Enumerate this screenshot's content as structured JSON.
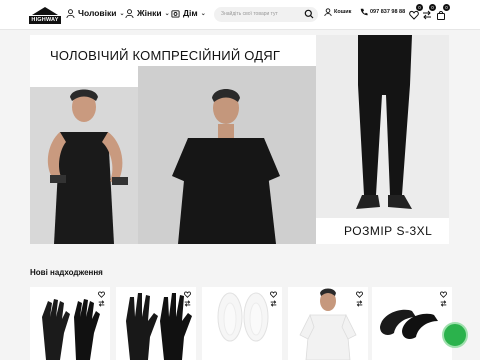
{
  "header": {
    "logo_text": "HIGHWAY",
    "nav": [
      {
        "label": "Чоловіки"
      },
      {
        "label": "Жінки"
      },
      {
        "label": "Дім"
      }
    ],
    "search_placeholder": "Знайдіть свої товари тут",
    "account_label": "Кошик",
    "phone": "097 837 98 88",
    "badges": {
      "wishlist": "0",
      "compare": "0",
      "cart": "0"
    }
  },
  "hero": {
    "title": "ЧОЛОВІЧИЙ КОМПРЕСІЙНИЙ ОДЯГ",
    "size_label": "РОЗМІР S-3XL"
  },
  "new_arrivals": {
    "title": "Нові надходження",
    "products": [
      {
        "name": "gloves-touch"
      },
      {
        "name": "gloves-sport"
      },
      {
        "name": "socks-white"
      },
      {
        "name": "tshirt-white"
      },
      {
        "name": "slides-black"
      }
    ]
  },
  "colors": {
    "accent": "#111111",
    "chat": "#2bb24c",
    "page_bg": "#f4f4f4"
  }
}
